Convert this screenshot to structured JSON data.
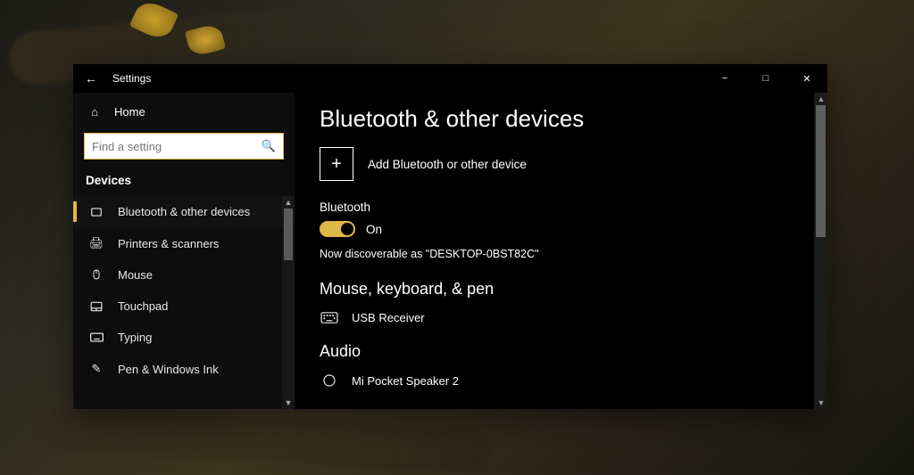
{
  "window": {
    "title": "Settings"
  },
  "sidebar": {
    "home_label": "Home",
    "search_placeholder": "Find a setting",
    "category": "Devices",
    "items": [
      {
        "icon": "bluetooth",
        "label": "Bluetooth & other devices",
        "active": true
      },
      {
        "icon": "printer",
        "label": "Printers & scanners",
        "active": false
      },
      {
        "icon": "mouse",
        "label": "Mouse",
        "active": false
      },
      {
        "icon": "touchpad",
        "label": "Touchpad",
        "active": false
      },
      {
        "icon": "typing",
        "label": "Typing",
        "active": false
      },
      {
        "icon": "pen",
        "label": "Pen & Windows Ink",
        "active": false
      }
    ]
  },
  "main": {
    "page_title": "Bluetooth & other devices",
    "add_label": "Add Bluetooth or other device",
    "bluetooth_heading": "Bluetooth",
    "toggle_state": "On",
    "discoverable_text": "Now discoverable as \"DESKTOP-0BST82C\"",
    "section_mouse": "Mouse, keyboard, & pen",
    "device_usb": "USB Receiver",
    "section_audio": "Audio",
    "device_speaker": "Mi Pocket Speaker 2"
  }
}
